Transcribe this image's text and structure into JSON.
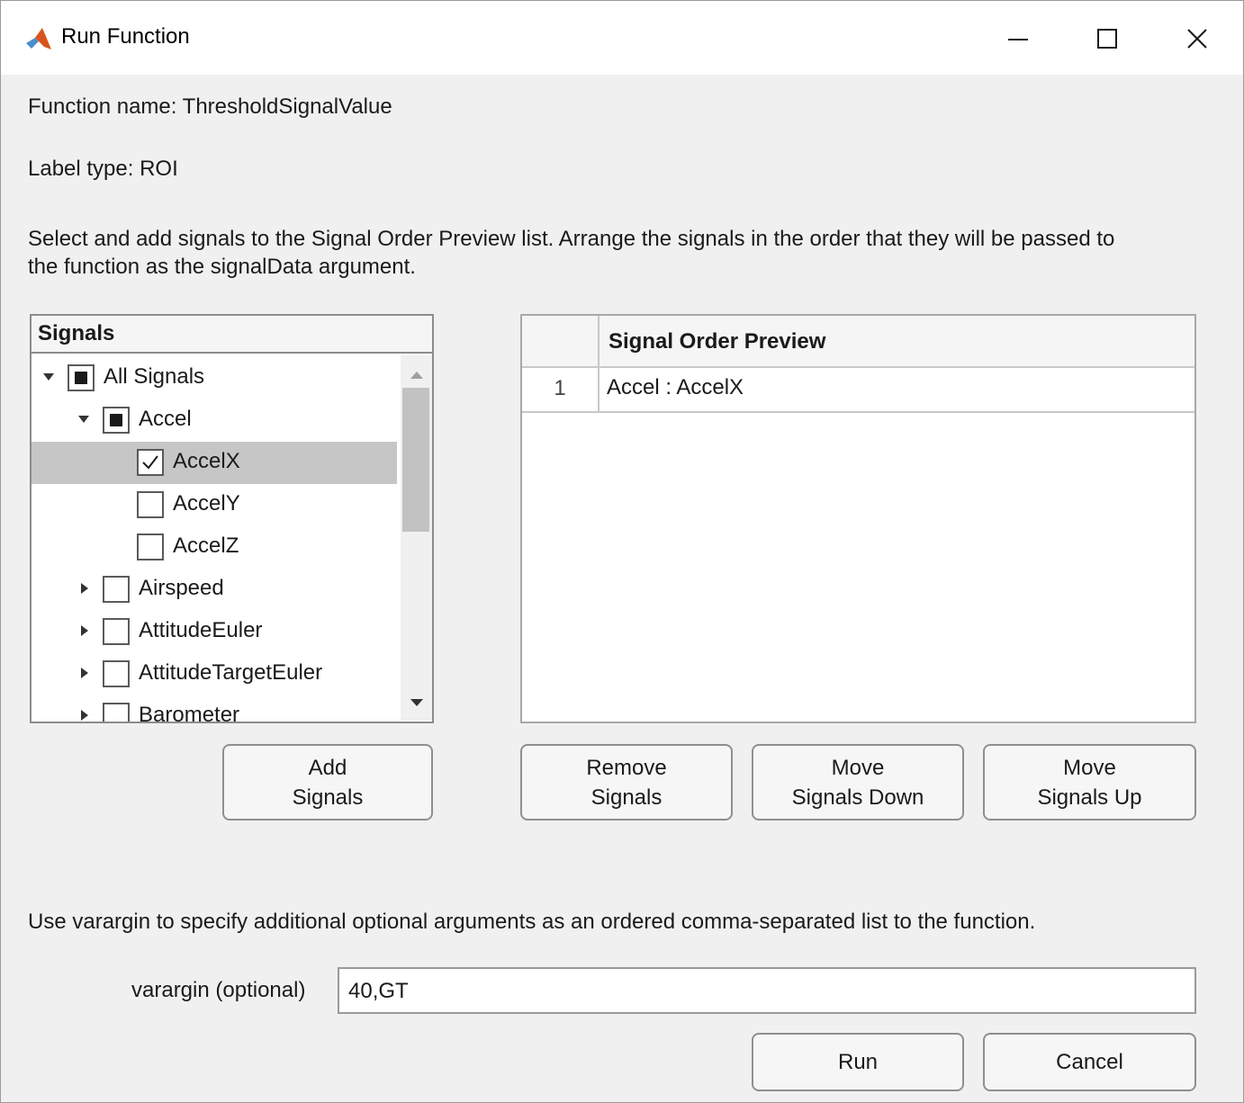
{
  "window": {
    "title": "Run Function",
    "icon": "matlab-logo-icon",
    "controls": [
      "minimize-icon",
      "maximize-icon",
      "close-icon"
    ]
  },
  "info": {
    "function_name": "Function name: ThresholdSignalValue",
    "label_type": "Label type: ROI",
    "instructions_line1": "Select and add signals to the Signal Order Preview list. Arrange the signals in the order that they will be passed to",
    "instructions_line2": "the function as the signalData argument."
  },
  "signals": {
    "header": "Signals",
    "tree": [
      {
        "label": "All Signals",
        "level": 0,
        "expanded": true,
        "state": "partial"
      },
      {
        "label": "Accel",
        "level": 1,
        "expanded": true,
        "state": "partial"
      },
      {
        "label": "AccelX",
        "level": 2,
        "state": "checked",
        "selected": true
      },
      {
        "label": "AccelY",
        "level": 2,
        "state": "unchecked"
      },
      {
        "label": "AccelZ",
        "level": 2,
        "state": "unchecked"
      },
      {
        "label": "Airspeed",
        "level": 1,
        "expanded": false,
        "state": "unchecked"
      },
      {
        "label": "AttitudeEuler",
        "level": 1,
        "expanded": false,
        "state": "unchecked"
      },
      {
        "label": "AttitudeTargetEuler",
        "level": 1,
        "expanded": false,
        "state": "unchecked"
      },
      {
        "label": "Barometer",
        "level": 1,
        "expanded": false,
        "state": "unchecked"
      }
    ]
  },
  "preview": {
    "header": "Signal Order Preview",
    "rows": [
      {
        "index": "1",
        "value": "Accel : AccelX"
      }
    ]
  },
  "buttons": {
    "add_line1": "Add",
    "add_line2": "Signals",
    "remove_line1": "Remove",
    "remove_line2": "Signals",
    "down_line1": "Move",
    "down_line2": "Signals Down",
    "up_line1": "Move",
    "up_line2": "Signals Up",
    "run": "Run",
    "cancel": "Cancel"
  },
  "varargin": {
    "description": "Use varargin to specify additional optional arguments as an ordered comma-separated list to the function.",
    "label": "varargin (optional)",
    "value": "40,GT"
  }
}
